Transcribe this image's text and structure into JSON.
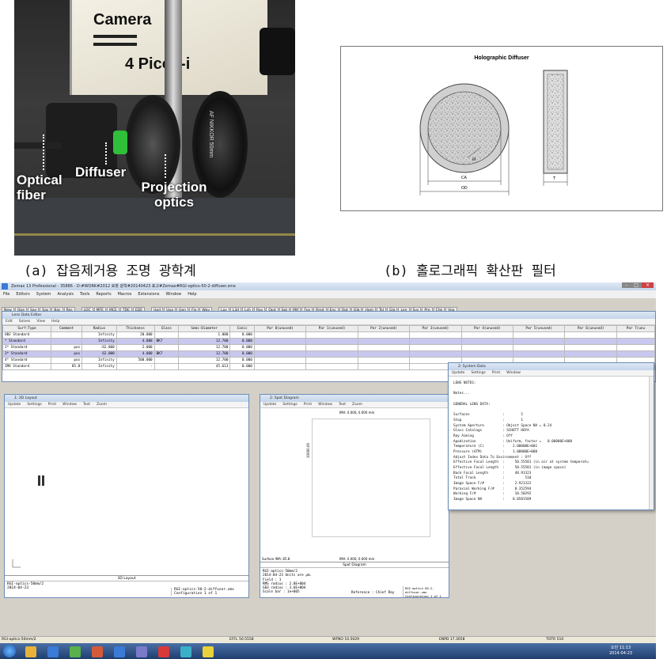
{
  "photo": {
    "camera_label": "Camera",
    "camera_model": "4 Picos-i",
    "lens_text": "AF NIKKOR 50mm",
    "labels": [
      "Optical fiber",
      "Diffuser",
      "Projection optics"
    ],
    "caption": "(a) 잡음제거용 조명 광학계"
  },
  "diffuser": {
    "title": "Holographic Diffuser",
    "dim_ca": "CA",
    "dim_od": "OD",
    "dim_t": "T",
    "dim_bf": "BF",
    "caption": "(b) 홀로그래픽 확산판 필터"
  },
  "app": {
    "title": "Zemax 13 Professional - 35886 - D:#WORK#2012 로봇 광학#20140423 표고#Zemax#RGI-optics-50-2-diffuser.zmx",
    "menu": [
      "File",
      "Editors",
      "System",
      "Analysis",
      "Tools",
      "Reports",
      "Macros",
      "Extensions",
      "Window",
      "Help"
    ],
    "toolbar1": [
      "New",
      "Ope",
      "Sav",
      "Sas",
      "Bac",
      "Res",
      "LOC",
      "MFE",
      "MCE",
      "TDE",
      "EDE",
      "Upd",
      "Upa",
      "Gen",
      "Fie",
      "Wav",
      "Lay",
      "L3d",
      "Lsh",
      "Ray",
      "Opd",
      "Spt",
      "Mtf",
      "Fps",
      "Rmd",
      "Enc",
      "Opt",
      "Glb",
      "Ham",
      "Tol",
      "Gla",
      "Len",
      "Sys",
      "Pre",
      "Chk",
      "Vop"
    ],
    "status": [
      "RGI-optics-50mm/2",
      "EFFL 50.5558",
      "WFNO 10.5029",
      "ENPD 17.3058",
      "TOTR 510"
    ],
    "clock_time": "오전 11:13",
    "clock_date": "2014-04-23"
  },
  "lde": {
    "title": "Lens Data Editor",
    "menu": [
      "Edit",
      "Solves",
      "View",
      "Help"
    ],
    "headers": [
      "Surf:Type",
      "Comment",
      "Radius",
      "Thickness",
      "Glass",
      "Semi-Diameter",
      "Conic",
      "Par 0(unused)",
      "Par 1(unused)",
      "Par 2(unused)",
      "Par 3(unused)",
      "Par 4(unused)",
      "Par 5(unused)",
      "Par 6(unused)",
      "Par 7(unu"
    ],
    "rows": [
      [
        "OBJ",
        "Standard",
        "",
        "Infinity",
        "20.000",
        "",
        "1.000",
        "0.000"
      ],
      [
        "*",
        "Standard",
        "",
        "Infinity",
        "4.000",
        "BK7",
        "12.700",
        "0.000"
      ],
      [
        "2*",
        "Standard",
        "pos",
        "-62.000",
        "2.000",
        "",
        "12.700",
        "0.000"
      ],
      [
        "3*",
        "Standard",
        "pos",
        "62.000",
        "4.000",
        "BK7",
        "12.700",
        "0.000"
      ],
      [
        "4*",
        "Standard",
        "pos",
        "Infinity",
        "500.000",
        "",
        "12.700",
        "0.000"
      ],
      [
        "IMA",
        "Standard",
        "85.8",
        "Infinity",
        "-",
        "",
        "45.613",
        "0.000"
      ]
    ]
  },
  "layout": {
    "title": "1: 3D Layout",
    "menu": [
      "Update",
      "Settings",
      "Print",
      "Window",
      "Text",
      "Zoom"
    ],
    "footer_title": "3D Layout",
    "footer_left": [
      "RGI-optics-50mm/2",
      "2014-04-23"
    ],
    "footer_file": "RGI-optics-50-2-diffuser.zmx",
    "footer_config": "Configuration 1 of 1"
  },
  "spot": {
    "title": "2: Spot Diagram",
    "menu": [
      "Update",
      "Settings",
      "Print",
      "Window",
      "Text",
      "Zoom"
    ],
    "top_label": "IMA: 0.000, 0.000 mm",
    "bottom_label": "IMA: 0.000, 0.000 mm",
    "surface_label": "Surface IMA: 85.8",
    "axis_label": "10000.00",
    "footer_title": "Spot Diagram",
    "footer_left": [
      "RGI-optics-50mm/2",
      "2014-04-23  Units are µm.",
      "Field      :      1",
      "RMS radius :  2.8E+004",
      "GEO radius :  3.6E+004",
      "Scale bar  : 1e+005"
    ],
    "reference": "Reference : Chief Ray",
    "footer_file": "RGI-optics-50-2-diffuser.zmx",
    "footer_config": "Configuration 1 of 1"
  },
  "sysdata": {
    "title": "2: System Data",
    "menu": [
      "Update",
      "Settings",
      "Print",
      "Window"
    ],
    "lines": [
      "LENS NOTES:",
      "",
      "Notes...",
      "",
      "GENERAL LENS DATA:",
      "",
      "Surfaces                :        5",
      "Stop                    :        1",
      "System Aperture         : Object Space NA = 0.24",
      "Glass Catalogs          : SCHOTT HOYA",
      "Ray Aiming              : Off",
      "Apodization             : Uniform, factor =   0.00000E+000",
      "Temperature (C)         :    2.00000E+001",
      "Pressure (ATM)          :    1.00000E+000",
      "Adjust Index Data To Environment : Off",
      "Effective Focal Length  :     50.55581 (in air at system temperatu",
      "Effective Focal Length  :     50.55581 (in image space)",
      "Back Focal Length       :     48.91323",
      "Total Track             :          510",
      "Image Space F/#         :     2.921322",
      "Paraxial Working F/#    :     8.352594",
      "Working F/#             :     10.50292",
      "Image Space NA          :    0.0581589"
    ]
  }
}
